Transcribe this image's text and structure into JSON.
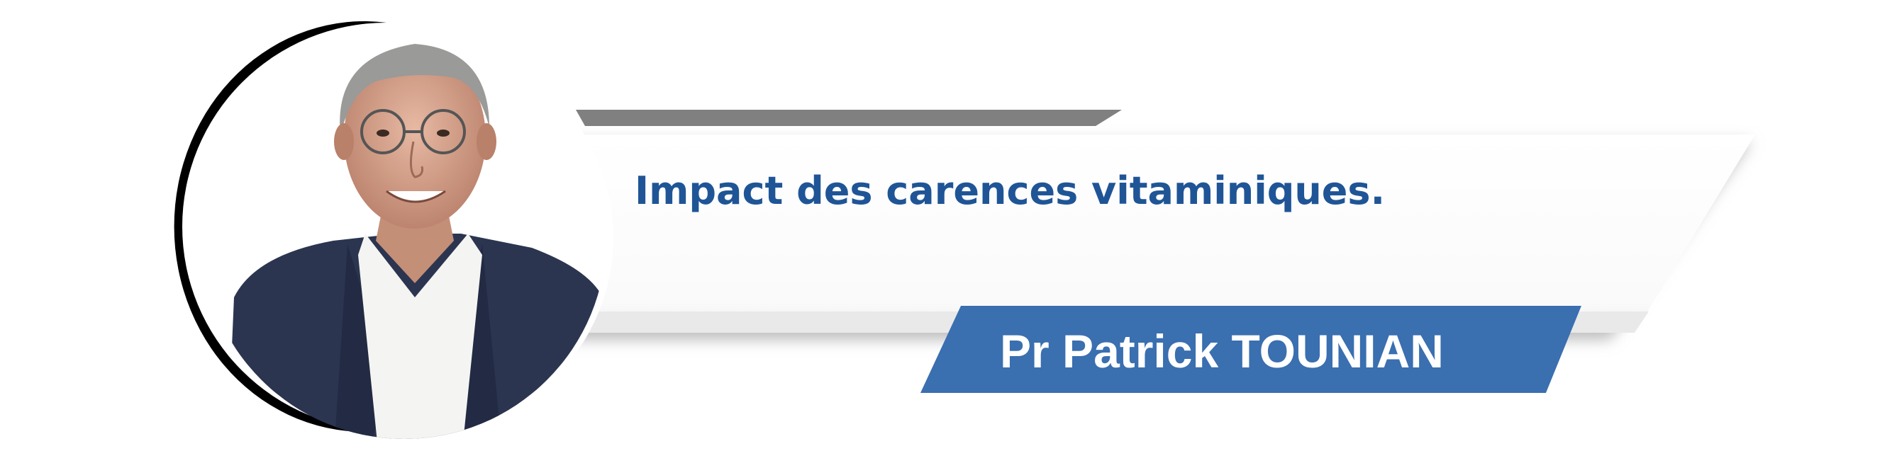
{
  "banner": {
    "title": "Impact des carences vitaminiques.",
    "speaker": "Pr Patrick TOUNIAN"
  },
  "colors": {
    "title_text": "#1f5596",
    "name_plate": "#3a6fb0",
    "top_bar": "#808080",
    "panel_shadow": "#c8c8c8",
    "circle_ring": "#000000"
  },
  "icons": {
    "portrait": "speaker-portrait"
  }
}
